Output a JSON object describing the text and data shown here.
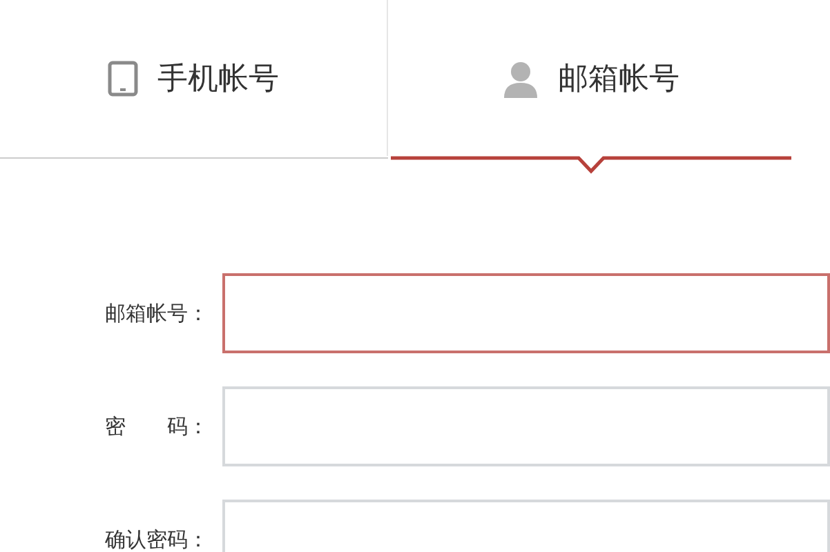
{
  "tabs": [
    {
      "label": "手机帐号",
      "kind": "phone",
      "selected": false
    },
    {
      "label": "邮箱帐号",
      "kind": "person",
      "selected": true
    }
  ],
  "form": {
    "fields": [
      {
        "label": "邮箱帐号：",
        "focused": true
      },
      {
        "label": "密　　码：",
        "focused": false
      },
      {
        "label": "确认密码：",
        "focused": false
      }
    ]
  }
}
